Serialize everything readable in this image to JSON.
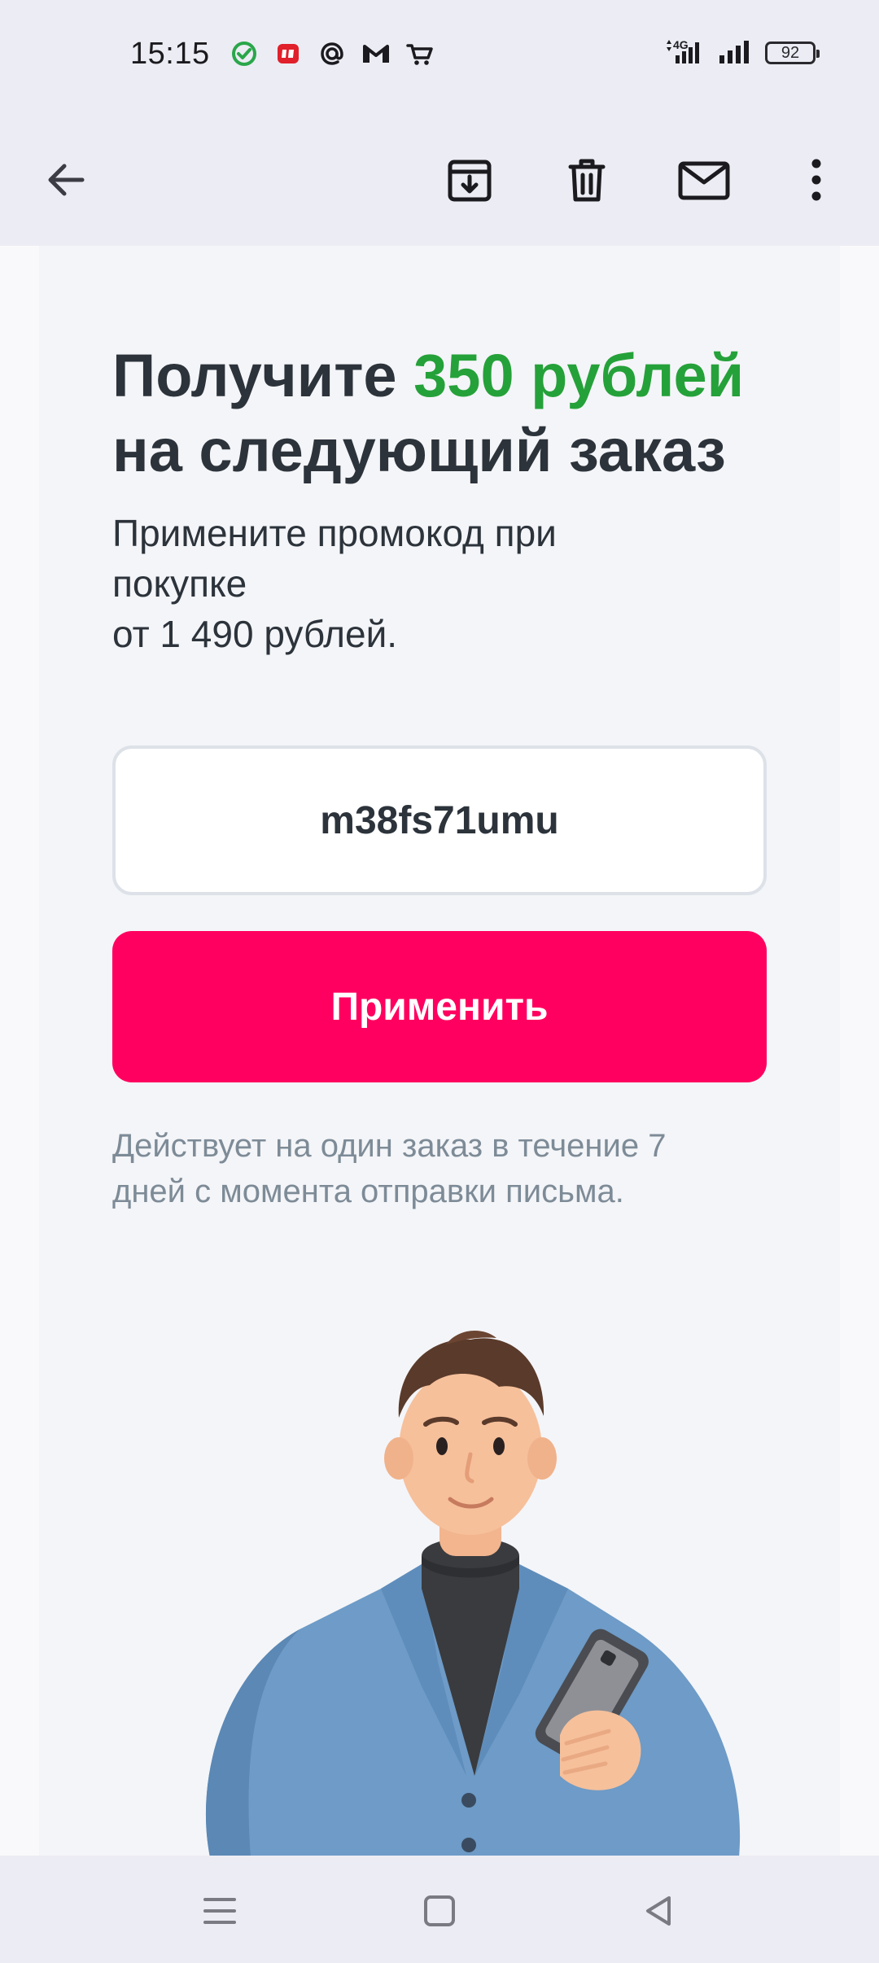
{
  "status_bar": {
    "time": "15:15",
    "network": "4G",
    "battery": "92",
    "notification_icons": [
      "check-circle-icon",
      "mts-app-icon",
      "at-sign-icon",
      "gmail-icon",
      "cart-icon"
    ]
  },
  "app_bar": {
    "icons": [
      "back-arrow-icon",
      "archive-icon",
      "trash-icon",
      "mail-icon",
      "more-vert-icon"
    ]
  },
  "email": {
    "headline_prefix": "Получите ",
    "headline_accent": "350 рублей",
    "headline_suffix": "на следующий заказ",
    "subtext_line1": "Примените промокод при",
    "subtext_line2": "покупке",
    "subtext_line3": "от 1 490 рублей.",
    "promo_code": "m38fs71umu",
    "apply_label": "Применить",
    "note_line1": "Действует на один заказ в течение 7",
    "note_line2": "дней с момента отправки письма."
  },
  "colors": {
    "accent_green": "#25a13a",
    "button_pink": "#ff0060",
    "headline_text": "#2c333b",
    "note_text": "#7d8b97"
  },
  "nav_bar": {
    "icons": [
      "menu-icon",
      "home-icon",
      "back-icon"
    ]
  }
}
